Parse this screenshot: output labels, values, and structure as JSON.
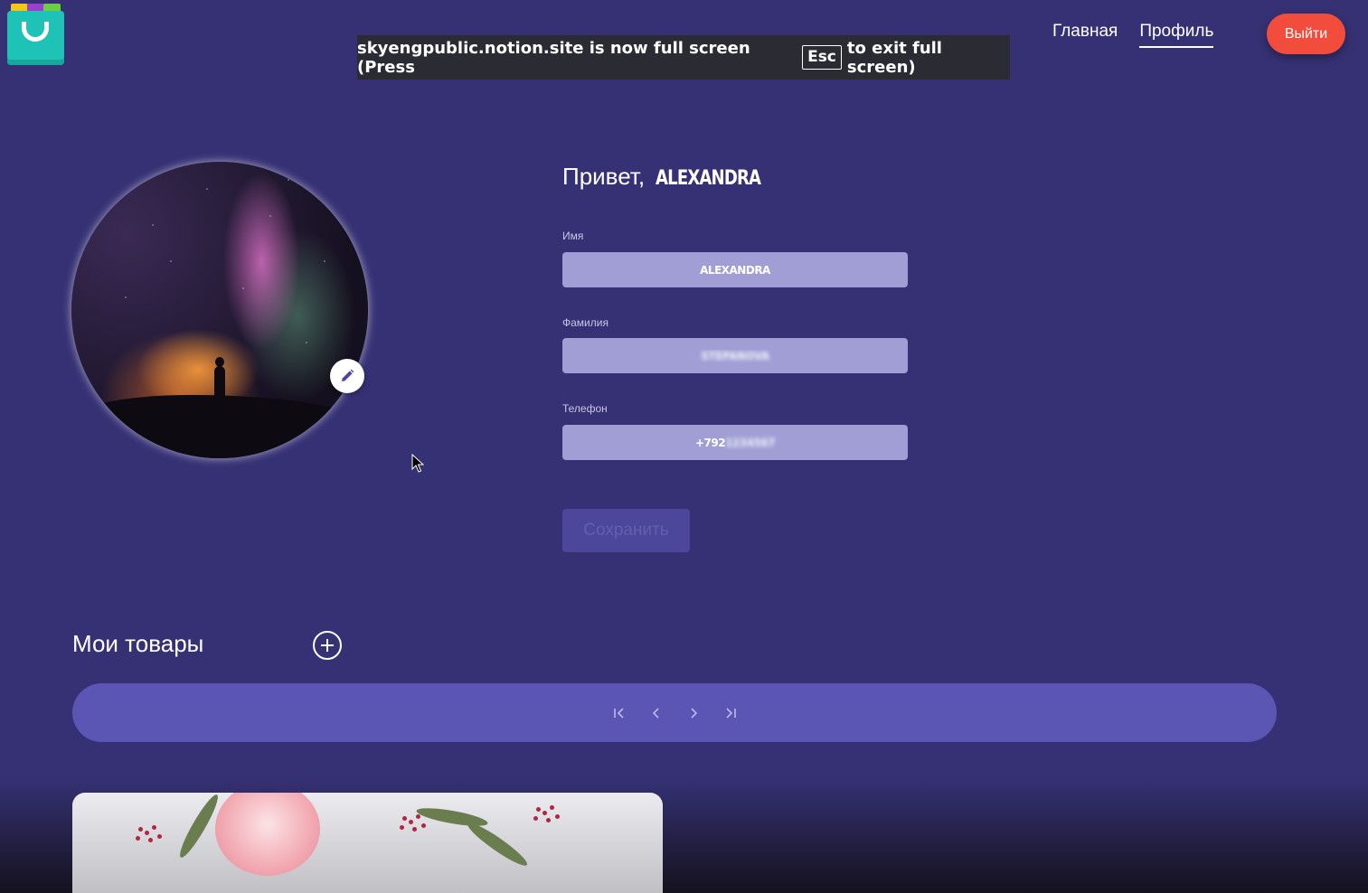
{
  "banner": {
    "text_before": "skyengpublic.notion.site is now full screen (Press",
    "key": "Esc",
    "text_after": "to exit full screen)"
  },
  "nav": {
    "home": "Главная",
    "profile": "Профиль",
    "logout": "Выйти"
  },
  "profile": {
    "greeting": "Привет,",
    "user_name": "ALEXANDRA",
    "first_name_label": "Имя",
    "first_name_value": "ALEXANDRA",
    "last_name_label": "Фамилия",
    "last_name_value": "STEPANOVA",
    "phone_label": "Телефон",
    "phone_prefix": "+792",
    "phone_rest": "1234567",
    "save_label": "Сохранить"
  },
  "goods": {
    "title": "Мои товары"
  },
  "colors": {
    "background": "#363174",
    "accent_red": "#f24c3d",
    "field_bg": "#a19ed6",
    "pager_bg": "#5b56b3"
  },
  "icons": {
    "edit": "pencil-icon",
    "add": "plus-circle-icon",
    "first": "first-page-icon",
    "prev": "chevron-left-icon",
    "next": "chevron-right-icon",
    "last": "last-page-icon"
  }
}
